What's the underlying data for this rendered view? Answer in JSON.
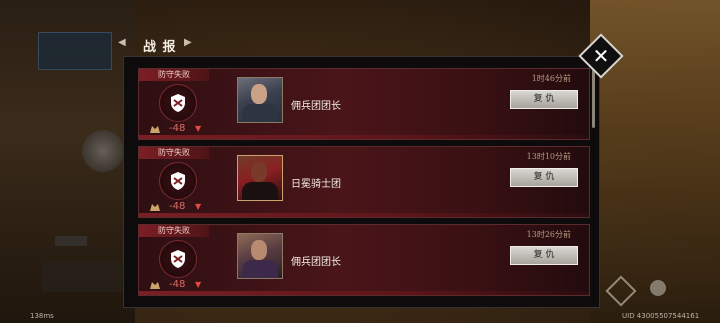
{
  "header": {
    "title": "战 报",
    "arrow_left": "◀",
    "arrow_right": "▶",
    "close_icon": "✕"
  },
  "footer": {
    "latency": "138ms",
    "uid": "UID 43005507544161"
  },
  "reports": [
    {
      "tag": "防守失败",
      "time": "1时46分前",
      "name": "佣兵团团长",
      "score": "-48",
      "score_trend_icon": "▼",
      "button_label": "复 仇",
      "portrait": "portrait-mercenary-captain"
    },
    {
      "tag": "防守失败",
      "time": "13时10分前",
      "name": "日冕骑士团",
      "score": "-48",
      "score_trend_icon": "▼",
      "button_label": "复 仇",
      "portrait": "portrait-corona-knights"
    },
    {
      "tag": "防守失败",
      "time": "13时26分前",
      "name": "佣兵团团长",
      "score": "-48",
      "score_trend_icon": "▼",
      "button_label": "复 仇",
      "portrait": "portrait-mercenary-captain-alt"
    }
  ],
  "colors": {
    "accent_red": "#7d1e25",
    "score_red": "#e06d65",
    "button_gray": "#d9d7d2"
  }
}
